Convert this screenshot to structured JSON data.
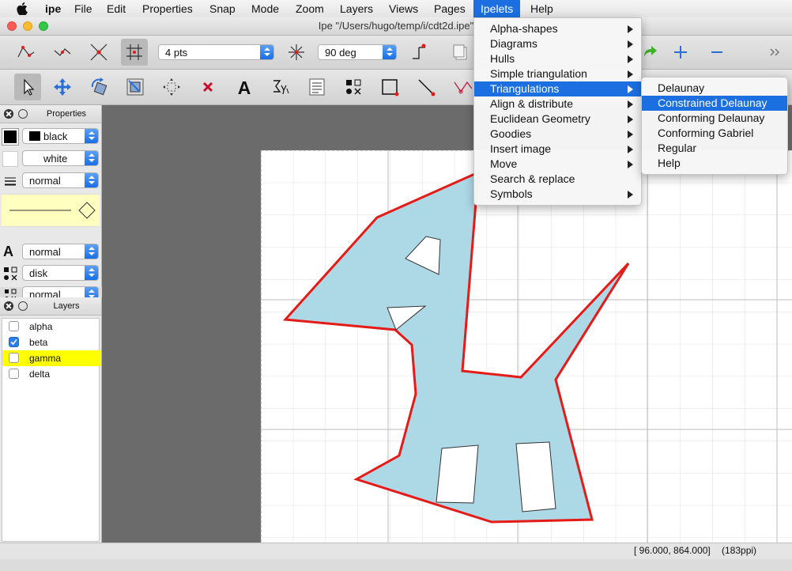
{
  "menubar": {
    "apple_icon": "apple-icon",
    "app_name": "ipe",
    "items": [
      "File",
      "Edit",
      "Properties",
      "Snap",
      "Mode",
      "Zoom",
      "Layers",
      "Views",
      "Pages",
      "Ipelets",
      "Help"
    ],
    "active": "Ipelets"
  },
  "window": {
    "title": "Ipe \"/Users/hugo/temp/i/cdt2d.ipe\""
  },
  "toolbar1": {
    "icons": [
      "snap-vertex-icon",
      "snap-boundary-icon",
      "snap-intersection-icon",
      "snap-grid-icon",
      "snap-angle-icon",
      "snap-auto-icon",
      "copy-icon",
      "redo-icon",
      "zoom-in-icon",
      "zoom-out-icon",
      "overflow-icon"
    ],
    "grid_size": "4 pts",
    "angle_size": "90 deg"
  },
  "toolbar2": {
    "icons": [
      "select-icon",
      "translate-icon",
      "rotate-icon",
      "stretch-icon",
      "pan-icon",
      "shred-icon",
      "text-icon",
      "math-icon",
      "paragraph-icon",
      "marks-icon",
      "rectangle-icon",
      "line-icon",
      "spline-icon"
    ]
  },
  "properties_panel": {
    "title": "Properties",
    "stroke": "black",
    "fill": "white",
    "pen": "normal",
    "text_size": "normal",
    "mark_shape": "disk",
    "mark_size": "normal"
  },
  "layers_panel": {
    "title": "Layers",
    "layers": [
      {
        "name": "alpha",
        "checked": false,
        "highlighted": false
      },
      {
        "name": "beta",
        "checked": true,
        "highlighted": false
      },
      {
        "name": "gamma",
        "checked": false,
        "highlighted": true
      },
      {
        "name": "delta",
        "checked": false,
        "highlighted": false
      }
    ]
  },
  "ipelets_menu": {
    "items": [
      {
        "label": "Alpha-shapes",
        "submenu": true
      },
      {
        "label": "Diagrams",
        "submenu": true
      },
      {
        "label": "Hulls",
        "submenu": true
      },
      {
        "label": "Simple triangulation",
        "submenu": true
      },
      {
        "label": "Triangulations",
        "submenu": true
      },
      {
        "label": "Align & distribute",
        "submenu": true
      },
      {
        "label": "Euclidean Geometry",
        "submenu": true
      },
      {
        "label": "Goodies",
        "submenu": true
      },
      {
        "label": "Insert image",
        "submenu": true
      },
      {
        "label": "Move",
        "submenu": true
      },
      {
        "label": "Search & replace",
        "submenu": false
      },
      {
        "label": "Symbols",
        "submenu": true
      }
    ],
    "highlighted": "Triangulations"
  },
  "triangulations_submenu": {
    "items": [
      "Delaunay",
      "Constrained Delaunay",
      "Conforming Delaunay",
      "Conforming Gabriel",
      "Regular",
      "Help"
    ],
    "highlighted": "Constrained Delaunay"
  },
  "statusbar": {
    "coordinates": "[ 96.000, 864.000]",
    "resolution": "(183ppi)"
  },
  "colors": {
    "menu_highlight": "#1b6fe0",
    "canvas_background": "#6b6b6b",
    "polygon_fill": "#add8e6",
    "polygon_stroke": "#e41b17",
    "layer_highlight": "#ffff00",
    "property_preview": "#ffffc0"
  }
}
